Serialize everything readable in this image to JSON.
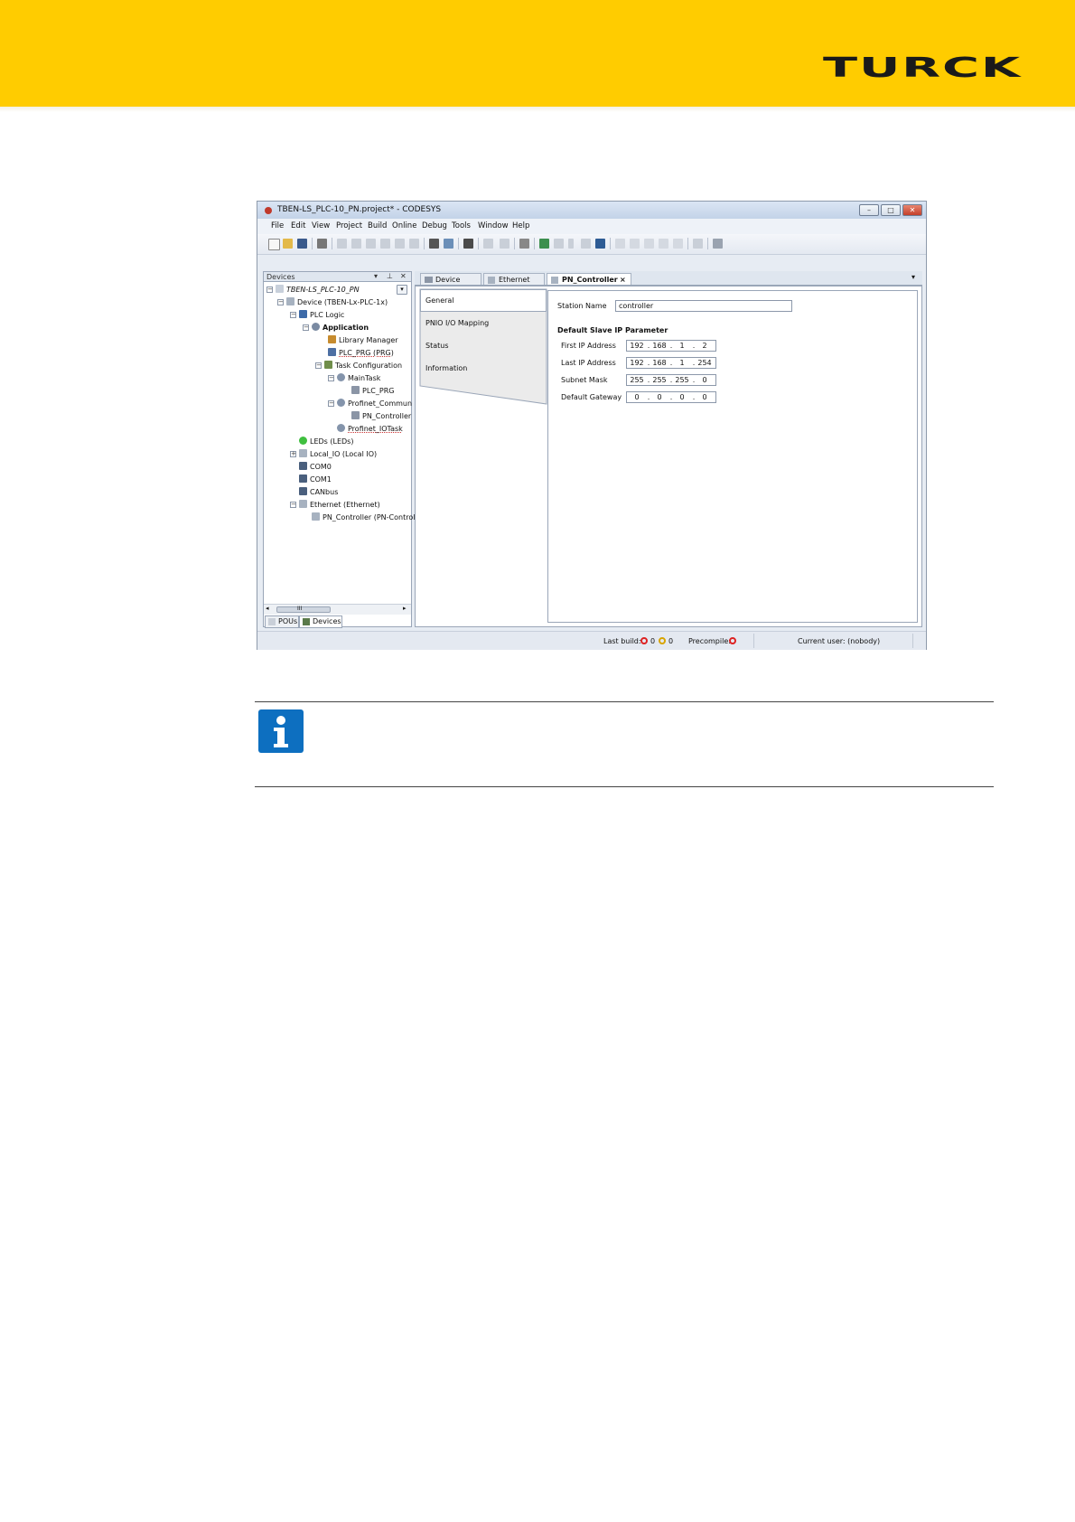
{
  "brand": {
    "logo_text": "TURCK",
    "band_color": "#ffcc00"
  },
  "window": {
    "title": "TBEN-LS_PLC-10_PN.project* - CODESYS",
    "menu": [
      "File",
      "Edit",
      "View",
      "Project",
      "Build",
      "Online",
      "Debug",
      "Tools",
      "Window",
      "Help"
    ]
  },
  "devices_pane": {
    "title": "Devices",
    "tree": [
      {
        "label": "TBEN-LS_PLC-10_PN",
        "icon": "project-icon"
      },
      {
        "label": "Device (TBEN-Lx-PLC-1x)",
        "icon": "device-icon"
      },
      {
        "label": "PLC Logic",
        "icon": "plc-logic-icon"
      },
      {
        "label": "Application",
        "icon": "application-icon"
      },
      {
        "label": "Library Manager",
        "icon": "library-icon"
      },
      {
        "label": "PLC_PRG (PRG)",
        "icon": "program-icon"
      },
      {
        "label": "Task Configuration",
        "icon": "task-config-icon"
      },
      {
        "label": "MainTask",
        "icon": "task-icon"
      },
      {
        "label": "PLC_PRG",
        "icon": "program-icon"
      },
      {
        "label": "Profinet_Commun",
        "icon": "task-icon"
      },
      {
        "label": "PN_Controller",
        "icon": "program-icon"
      },
      {
        "label": "Profinet_IOTask",
        "icon": "task-icon"
      },
      {
        "label": "LEDs (LEDs)",
        "icon": "led-icon"
      },
      {
        "label": "Local_IO (Local IO)",
        "icon": "module-icon"
      },
      {
        "label": "COM0",
        "icon": "serial-icon"
      },
      {
        "label": "COM1",
        "icon": "serial-icon"
      },
      {
        "label": "CANbus",
        "icon": "serial-icon"
      },
      {
        "label": "Ethernet (Ethernet)",
        "icon": "module-icon"
      },
      {
        "label": "PN_Controller (PN-Control",
        "icon": "module-icon"
      }
    ],
    "scroll_label": "III",
    "bottom_tabs": [
      "POUs",
      "Devices"
    ]
  },
  "editor": {
    "tabs": [
      {
        "label": "Device"
      },
      {
        "label": "Ethernet"
      },
      {
        "label": "PN_Controller",
        "close": "×"
      }
    ],
    "side_tabs": [
      "General",
      "PNIO I/O Mapping",
      "Status",
      "Information"
    ],
    "station_name_label": "Station Name",
    "station_name_value": "controller",
    "section_title": "Default Slave IP Parameter",
    "ip_rows": [
      {
        "label": "First IP Address",
        "octets": [
          "192",
          "168",
          "1",
          "2"
        ]
      },
      {
        "label": "Last IP Address",
        "octets": [
          "192",
          "168",
          "1",
          "254"
        ]
      },
      {
        "label": "Subnet Mask",
        "octets": [
          "255",
          "255",
          "255",
          "0"
        ]
      },
      {
        "label": "Default Gateway",
        "octets": [
          "0",
          "0",
          "0",
          "0"
        ]
      }
    ]
  },
  "statusbar": {
    "last_build_label": "Last build:",
    "errors": "0",
    "warnings": "0",
    "precompile_label": "Precompile:",
    "user": "Current user: (nobody)"
  },
  "info_box": {
    "icon": "info-icon"
  }
}
